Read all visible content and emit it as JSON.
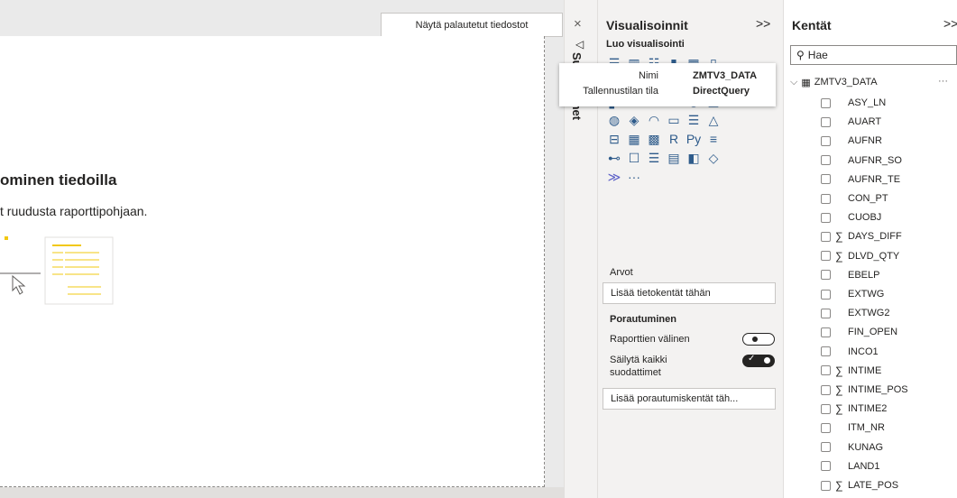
{
  "canvas": {
    "restore_button": "Näytä palautetut tiedostot",
    "heading": "ominen tiedoilla",
    "subtext": "t ruudusta raporttipohjaan."
  },
  "filters": {
    "close_icon": "×",
    "label": "Suodattimet"
  },
  "visualizations": {
    "title": "Visualisoinnit",
    "collapse_icon": ">>",
    "subtitle": "Luo visualisointi",
    "tooltip": {
      "name_key": "Nimi",
      "name_value": "ZMTV3_DATA",
      "mode_key": "Tallennustilan tila",
      "mode_value": "DirectQuery"
    },
    "icons": [
      [
        "stacked-bar-icon",
        "clustered-bar-icon",
        "stacked-bar-100-icon",
        "stacked-column-icon",
        "clustered-column-icon",
        "column-100-icon"
      ],
      [
        "line-chart-icon",
        "area-chart-icon",
        "stacked-area-icon",
        "line-column-icon",
        "line-clustered-icon",
        "ribbon-chart-icon"
      ],
      [
        "waterfall-icon",
        "funnel-icon",
        "scatter-icon",
        "pie-chart-icon",
        "donut-chart-icon",
        "treemap-icon"
      ],
      [
        "map-icon",
        "filled-map-icon",
        "gauge-icon",
        "card-icon",
        "multi-row-card-icon",
        "kpi-icon"
      ],
      [
        "slicer-icon",
        "table-icon",
        "matrix-icon",
        "r-visual-icon",
        "python-visual-icon",
        "key-influencers-icon"
      ],
      [
        "decomposition-tree-icon",
        "qa-icon",
        "smart-narrative-icon",
        "paginated-report-icon",
        "power-apps-icon",
        "power-automate-icon"
      ],
      [
        "get-more-visuals-icon",
        "more-options-icon"
      ]
    ],
    "icon_glyphs": [
      [
        "☰",
        "▥",
        "☷",
        "▮",
        "▦",
        "▯"
      ],
      [
        "⟋",
        "◭",
        "◬",
        "▟",
        "▙",
        "≋"
      ],
      [
        "▞",
        "⏷",
        "⁘",
        "◔",
        "◎",
        "▣"
      ],
      [
        "◍",
        "◈",
        "◠",
        "▭",
        "☰",
        "△"
      ],
      [
        "⊟",
        "▦",
        "▩",
        "R",
        "Py",
        "≡"
      ],
      [
        "⊷",
        "☐",
        "☰",
        "▤",
        "◧",
        "◇"
      ],
      [
        "≫",
        "···"
      ]
    ],
    "values_label": "Arvot",
    "values_well": "Lisää tietokentät tähän",
    "drill_title": "Porautuminen",
    "cross_report_label": "Raporttien välinen",
    "keep_filters_label": "Säilytä kaikki suodattimet",
    "drill_well": "Lisää porautumiskentät täh..."
  },
  "fields": {
    "title": "Kentät",
    "collapse_icon": ">>",
    "search_placeholder": "Hae",
    "table_name": "ZMTV3_DATA",
    "table_more": "···",
    "items": [
      {
        "name": "ASY_LN",
        "sigma": ""
      },
      {
        "name": "AUART",
        "sigma": ""
      },
      {
        "name": "AUFNR",
        "sigma": ""
      },
      {
        "name": "AUFNR_SO",
        "sigma": ""
      },
      {
        "name": "AUFNR_TE",
        "sigma": ""
      },
      {
        "name": "CON_PT",
        "sigma": ""
      },
      {
        "name": "CUOBJ",
        "sigma": ""
      },
      {
        "name": "DAYS_DIFF",
        "sigma": "∑"
      },
      {
        "name": "DLVD_QTY",
        "sigma": "∑"
      },
      {
        "name": "EBELP",
        "sigma": ""
      },
      {
        "name": "EXTWG",
        "sigma": ""
      },
      {
        "name": "EXTWG2",
        "sigma": ""
      },
      {
        "name": "FIN_OPEN",
        "sigma": ""
      },
      {
        "name": "INCO1",
        "sigma": ""
      },
      {
        "name": "INTIME",
        "sigma": "∑"
      },
      {
        "name": "INTIME_POS",
        "sigma": "∑"
      },
      {
        "name": "INTIME2",
        "sigma": "∑"
      },
      {
        "name": "ITM_NR",
        "sigma": ""
      },
      {
        "name": "KUNAG",
        "sigma": ""
      },
      {
        "name": "LAND1",
        "sigma": ""
      },
      {
        "name": "LATE_POS",
        "sigma": "∑"
      }
    ]
  }
}
